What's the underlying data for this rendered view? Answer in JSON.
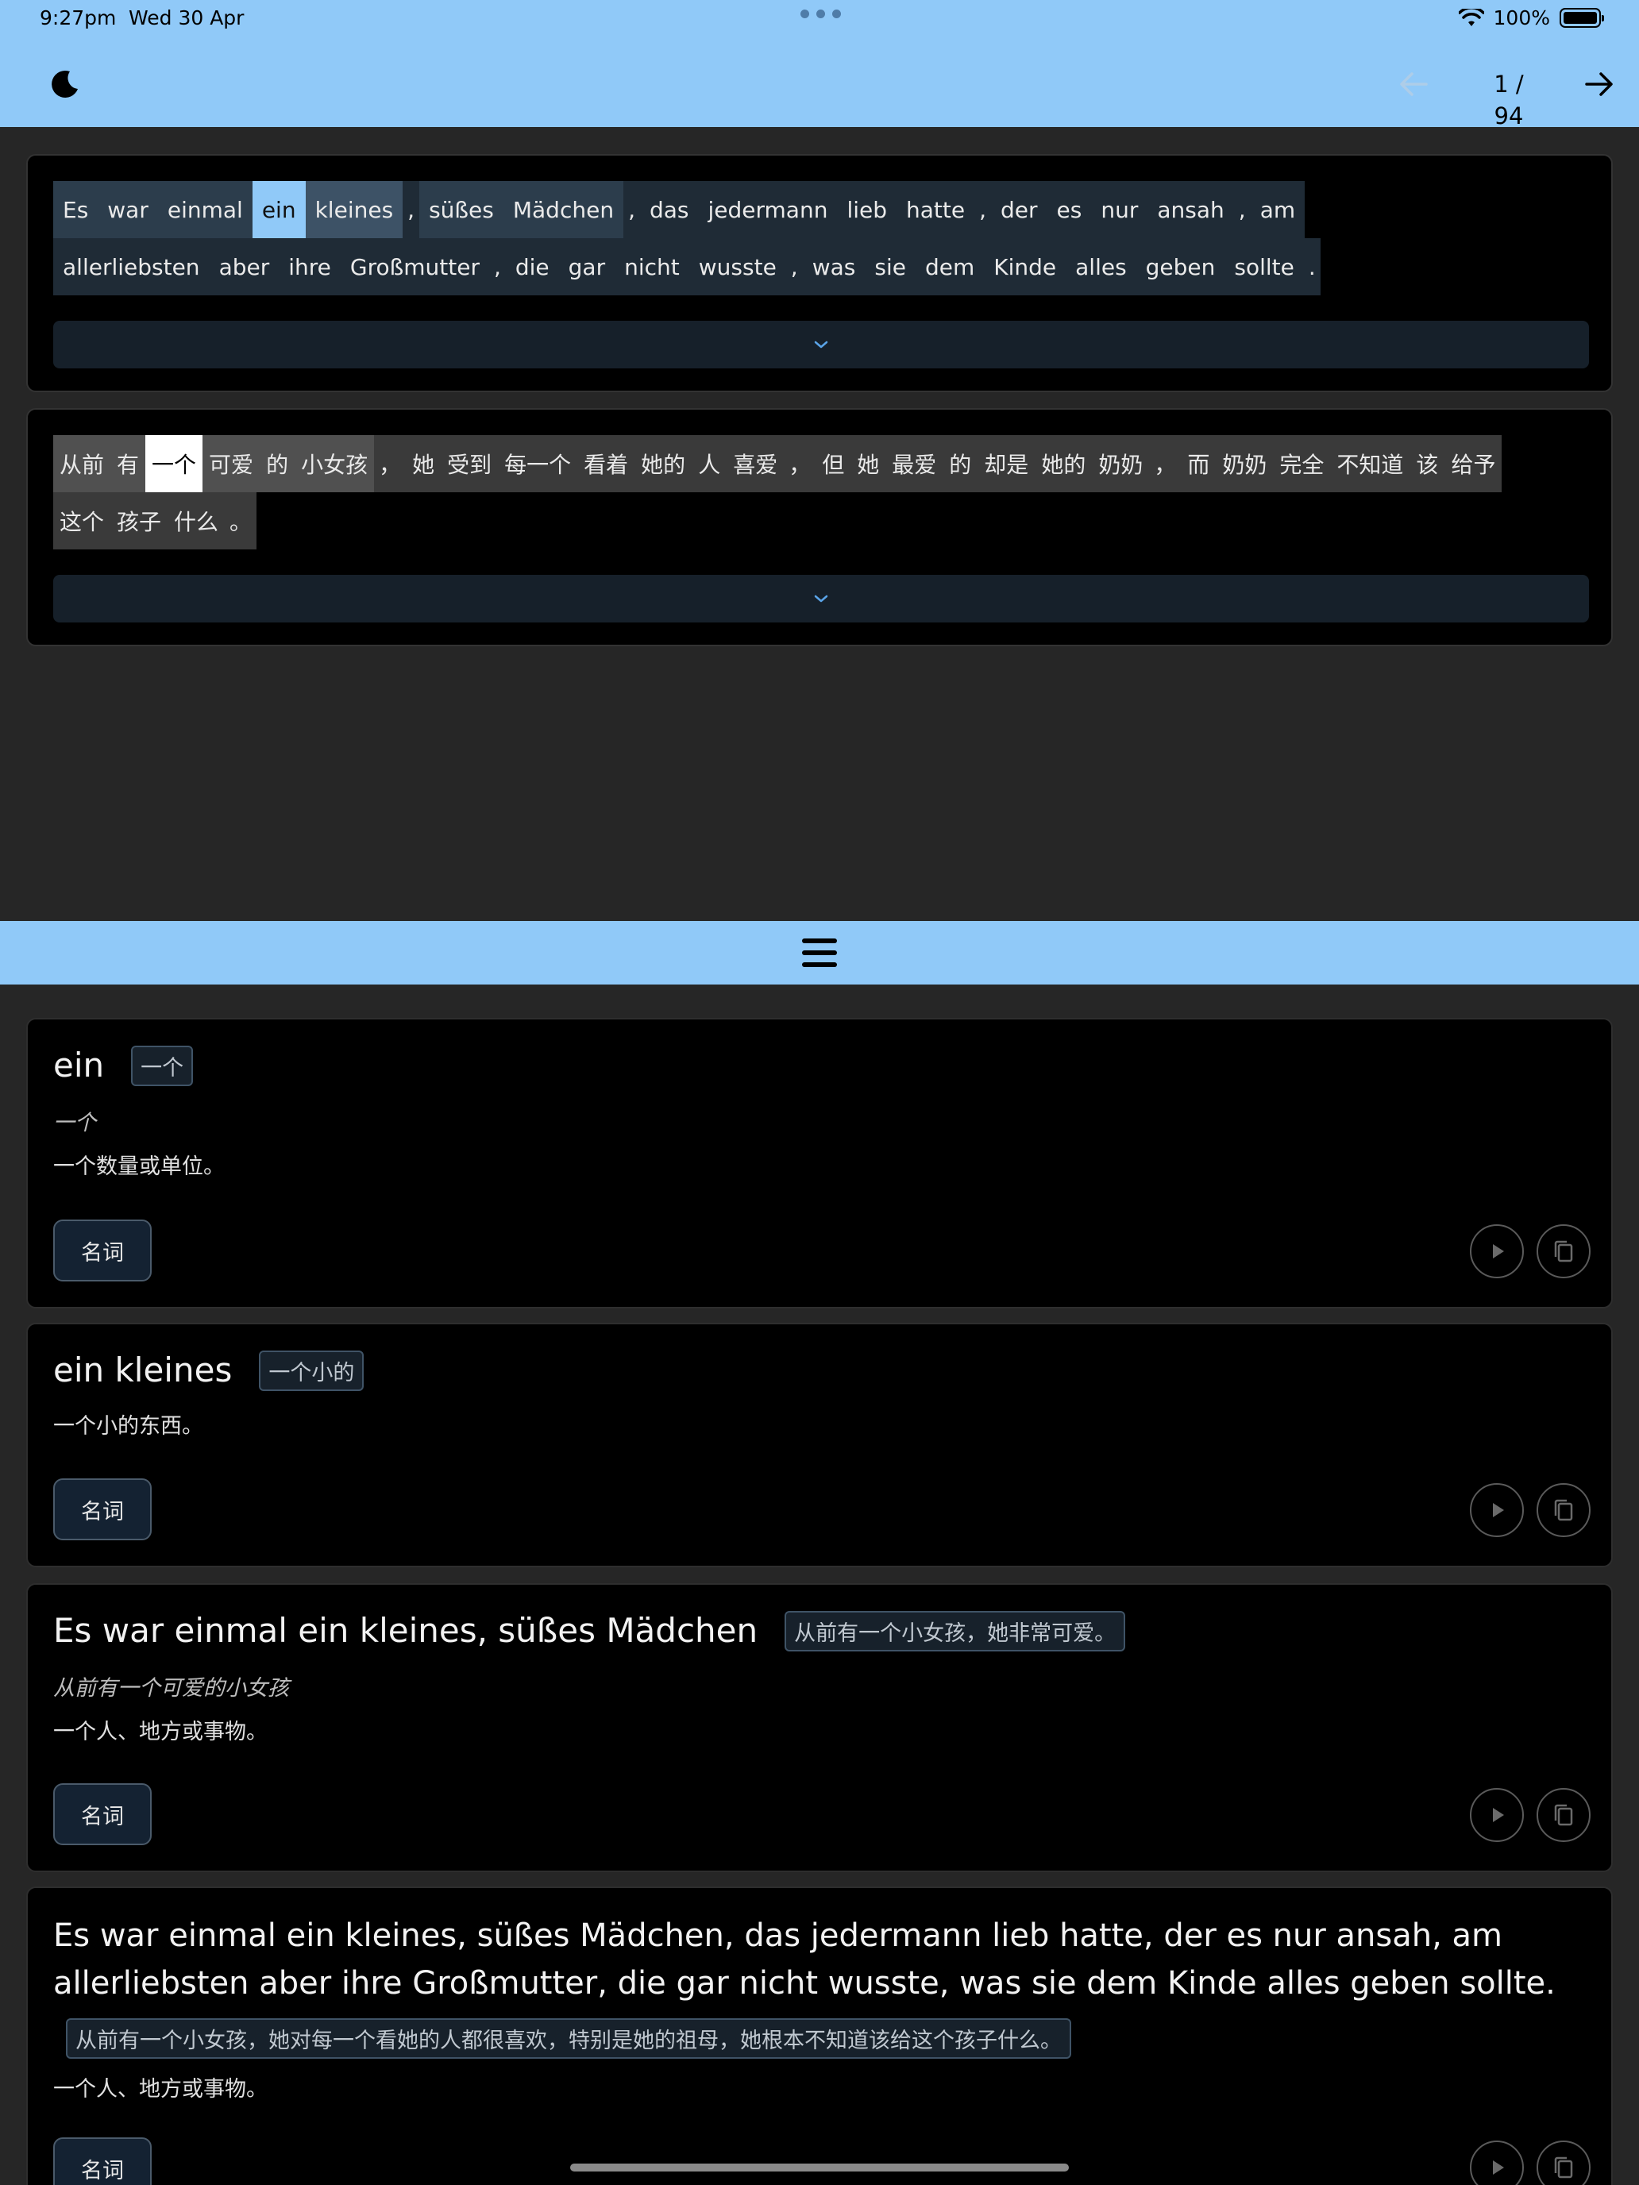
{
  "status": {
    "time": "9:27pm",
    "date": "Wed 30 Apr",
    "battery": "100%"
  },
  "nav": {
    "page": "1 / 94"
  },
  "german": {
    "lines": [
      [
        {
          "t": "Es",
          "hl": "group"
        },
        {
          "t": "war",
          "hl": "group"
        },
        {
          "t": "einmal",
          "hl": "group"
        },
        {
          "t": "ein",
          "hl": "selected"
        },
        {
          "t": "kleines",
          "hl": "phrase"
        },
        {
          "t": ",",
          "p": true
        },
        {
          "t": "süßes",
          "hl": "group"
        },
        {
          "t": "Mädchen",
          "hl": "group"
        },
        {
          "t": ",",
          "p": true
        },
        {
          "t": "das"
        },
        {
          "t": "jedermann"
        },
        {
          "t": "lieb"
        },
        {
          "t": "hatte"
        },
        {
          "t": ",",
          "p": true
        },
        {
          "t": "der"
        },
        {
          "t": "es"
        },
        {
          "t": "nur"
        },
        {
          "t": "ansah"
        },
        {
          "t": ",",
          "p": true
        },
        {
          "t": "am"
        }
      ],
      [
        {
          "t": "allerliebsten"
        },
        {
          "t": "aber"
        },
        {
          "t": "ihre"
        },
        {
          "t": "Großmutter"
        },
        {
          "t": ",",
          "p": true
        },
        {
          "t": "die"
        },
        {
          "t": "gar"
        },
        {
          "t": "nicht"
        },
        {
          "t": "wusste"
        },
        {
          "t": ",",
          "p": true
        },
        {
          "t": "was"
        },
        {
          "t": "sie"
        },
        {
          "t": "dem"
        },
        {
          "t": "Kinde"
        },
        {
          "t": "alles"
        },
        {
          "t": "geben"
        },
        {
          "t": "sollte"
        },
        {
          "t": ".",
          "p": true
        }
      ]
    ]
  },
  "chinese": {
    "lines": [
      [
        {
          "t": "从前",
          "hl": "grey"
        },
        {
          "t": "有",
          "hl": "grey"
        },
        {
          "t": "一个",
          "hl": "white"
        },
        {
          "t": "可爱",
          "hl": "grey"
        },
        {
          "t": "的",
          "hl": "grey"
        },
        {
          "t": "小女孩",
          "hl": "grey"
        },
        {
          "t": "，",
          "p": true
        },
        {
          "t": "她"
        },
        {
          "t": "受到"
        },
        {
          "t": "每一个"
        },
        {
          "t": "看着"
        },
        {
          "t": "她的"
        },
        {
          "t": "人"
        },
        {
          "t": "喜爱"
        },
        {
          "t": "，",
          "p": true
        },
        {
          "t": "但"
        },
        {
          "t": "她"
        },
        {
          "t": "最爱"
        },
        {
          "t": "的"
        },
        {
          "t": "却是"
        },
        {
          "t": "她的"
        },
        {
          "t": "奶奶"
        },
        {
          "t": "，",
          "p": true
        },
        {
          "t": "而"
        },
        {
          "t": "奶奶"
        },
        {
          "t": "完全"
        },
        {
          "t": "不知道"
        },
        {
          "t": "该"
        },
        {
          "t": "给予"
        }
      ],
      [
        {
          "t": "这个"
        },
        {
          "t": "孩子"
        },
        {
          "t": "什么"
        },
        {
          "t": "。",
          "p": true
        }
      ]
    ]
  },
  "cards": [
    {
      "term": "ein",
      "translation": "一个",
      "alt": "一个",
      "gloss": "一个数量或单位。",
      "pos": "名词"
    },
    {
      "term": "ein kleines",
      "translation": "一个小的",
      "gloss": "一个小的东西。",
      "pos": "名词"
    },
    {
      "term": "Es war einmal ein kleines, süßes Mädchen",
      "translation": "从前有一个小女孩，她非常可爱。",
      "alt": "从前有一个可爱的小女孩",
      "gloss": "一个人、地方或事物。",
      "pos": "名词"
    },
    {
      "term": "Es war einmal ein kleines, süßes Mädchen, das jedermann lieb hatte, der es nur ansah, am allerliebsten aber ihre Großmutter, die gar nicht wusste, was sie dem Kinde alles geben sollte.",
      "translation": "从前有一个小女孩，她对每一个看她的人都很喜欢，特别是她的祖母，她根本不知道该给这个孩子什么。",
      "gloss": "一个人、地方或事物。",
      "pos": "名词"
    }
  ],
  "colors": {
    "accent": "#90c9f8",
    "background": "#262626",
    "card": "#000000"
  },
  "icons": [
    "moon-icon",
    "arrow-left-icon",
    "arrow-right-icon",
    "chevron-down-icon",
    "menu-icon",
    "play-icon",
    "copy-icon",
    "wifi-icon",
    "battery-icon"
  ]
}
